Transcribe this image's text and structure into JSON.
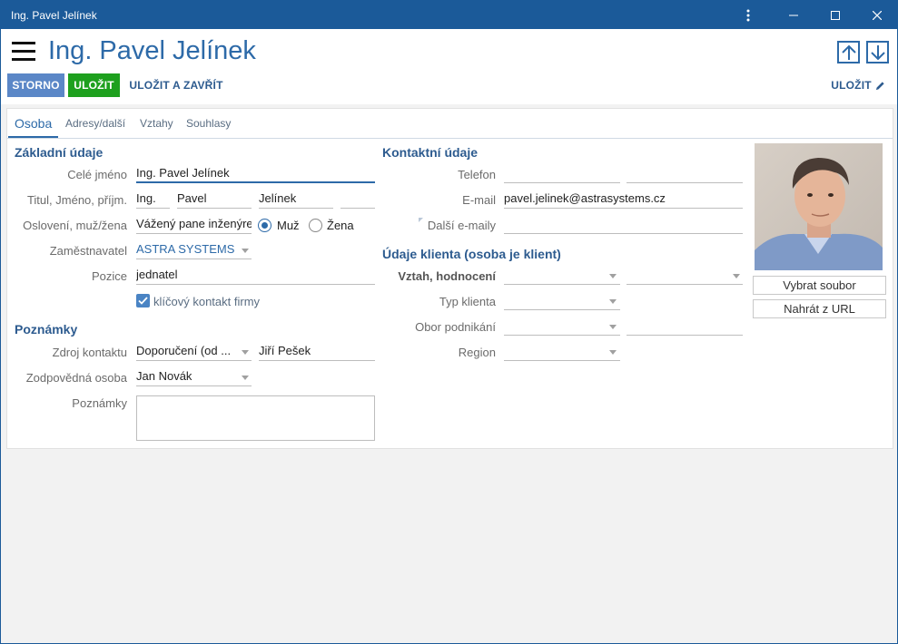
{
  "window": {
    "title": "Ing. Pavel Jelínek",
    "icons": [
      "more-icon",
      "minimize-icon",
      "maximize-icon",
      "close-icon"
    ]
  },
  "header": {
    "title": "Ing. Pavel Jelínek",
    "buttons": {
      "storno": "STORNO",
      "ulozit": "ULOŽIT",
      "ulozit_zavrit": "ULOŽIT A ZAVŘÍT",
      "ulozit_right": "ULOŽIT"
    }
  },
  "tabs": [
    "Osoba",
    "Adresy/další",
    "Vztahy",
    "Souhlasy"
  ],
  "active_tab": "Osoba",
  "zakladni": {
    "title": "Základní údaje",
    "cele_jmeno_label": "Celé jméno",
    "cele_jmeno": "Ing. Pavel Jelínek",
    "titul_label": "Titul, Jméno, příjm.",
    "titul": "Ing.",
    "jmeno": "Pavel",
    "prijmeni": "Jelínek",
    "titul_za": "",
    "osloveni_label": "Oslovení, muž/žena",
    "osloveni": "Vážený pane inženýre",
    "muz": "Muž",
    "zena": "Žena",
    "gender_selected": "Muž",
    "zamestnavatel_label": "Zaměstnavatel",
    "zamestnavatel": "ASTRA SYSTEMS",
    "pozice_label": "Pozice",
    "pozice": "jednatel",
    "klicovy_kontakt": "klíčový kontakt firmy",
    "klicovy_checked": true
  },
  "poznamky": {
    "title": "Poznámky",
    "zdroj_label": "Zdroj kontaktu",
    "zdroj": "Doporučení (od ...",
    "zdroj_osoba": "Jiří Pešek",
    "zodpovedna_label": "Zodpovědná osoba",
    "zodpovedna": "Jan Novák",
    "poznamky_label": "Poznámky",
    "poznamky_value": ""
  },
  "kontaktni": {
    "title": "Kontaktní údaje",
    "telefon_label": "Telefon",
    "telefon": "",
    "telefon2": "",
    "email_label": "E-mail",
    "email": "pavel.jelinek@astrasystems.cz",
    "dalsi_label": "Další e-maily",
    "dalsi": ""
  },
  "klient": {
    "title": "Údaje klienta (osoba je klient)",
    "vztah_label": "Vztah, hodnocení",
    "vztah": "",
    "hodnoceni": "",
    "typ_label": "Typ klienta",
    "typ": "",
    "obor_label": "Obor podnikání",
    "obor": "",
    "obor2": "",
    "region_label": "Region",
    "region": ""
  },
  "photo": {
    "vybrat": "Vybrat soubor",
    "nahrat": "Nahrát z URL"
  },
  "colors": {
    "titlebar": "#1b5a99",
    "accent": "#2d6aa8",
    "storno": "#5b87c7",
    "save": "#1ea01e"
  }
}
